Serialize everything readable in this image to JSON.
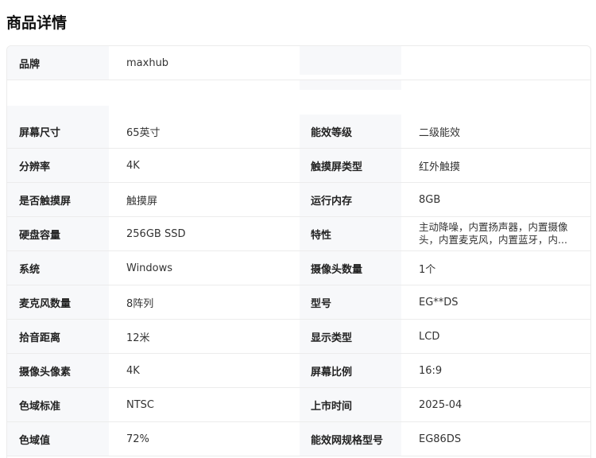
{
  "page": {
    "title": "商品详情"
  },
  "rows": [
    {
      "l1": "品牌",
      "v1": "maxhub",
      "l2": "",
      "v2": ""
    },
    {
      "l1": "屏幕尺寸",
      "v1": "65英寸",
      "l2": "能效等级",
      "v2": "二级能效"
    },
    {
      "l1": "分辨率",
      "v1": "4K",
      "l2": "触摸屏类型",
      "v2": "红外触摸"
    },
    {
      "l1": "是否触摸屏",
      "v1": "触摸屏",
      "l2": "运行内存",
      "v2": "8GB"
    },
    {
      "l1": "硬盘容量",
      "v1": "256GB SSD",
      "l2": "特性",
      "v2": "主动降噪，内置扬声器，内置摄像头，内置麦克风，内置蓝牙，内..."
    },
    {
      "l1": "系统",
      "v1": "Windows",
      "l2": "摄像头数量",
      "v2": "1个"
    },
    {
      "l1": "麦克风数量",
      "v1": "8阵列",
      "l2": "型号",
      "v2": "EG**DS"
    },
    {
      "l1": "拾音距离",
      "v1": "12米",
      "l2": "显示类型",
      "v2": "LCD"
    },
    {
      "l1": "摄像头像素",
      "v1": "4K",
      "l2": "屏幕比例",
      "v2": "16:9"
    },
    {
      "l1": "色域标准",
      "v1": "NTSC",
      "l2": "上市时间",
      "v2": "2025-04"
    },
    {
      "l1": "色域值",
      "v1": "72%",
      "l2": "能效网规格型号",
      "v2": "EG86DS"
    }
  ]
}
